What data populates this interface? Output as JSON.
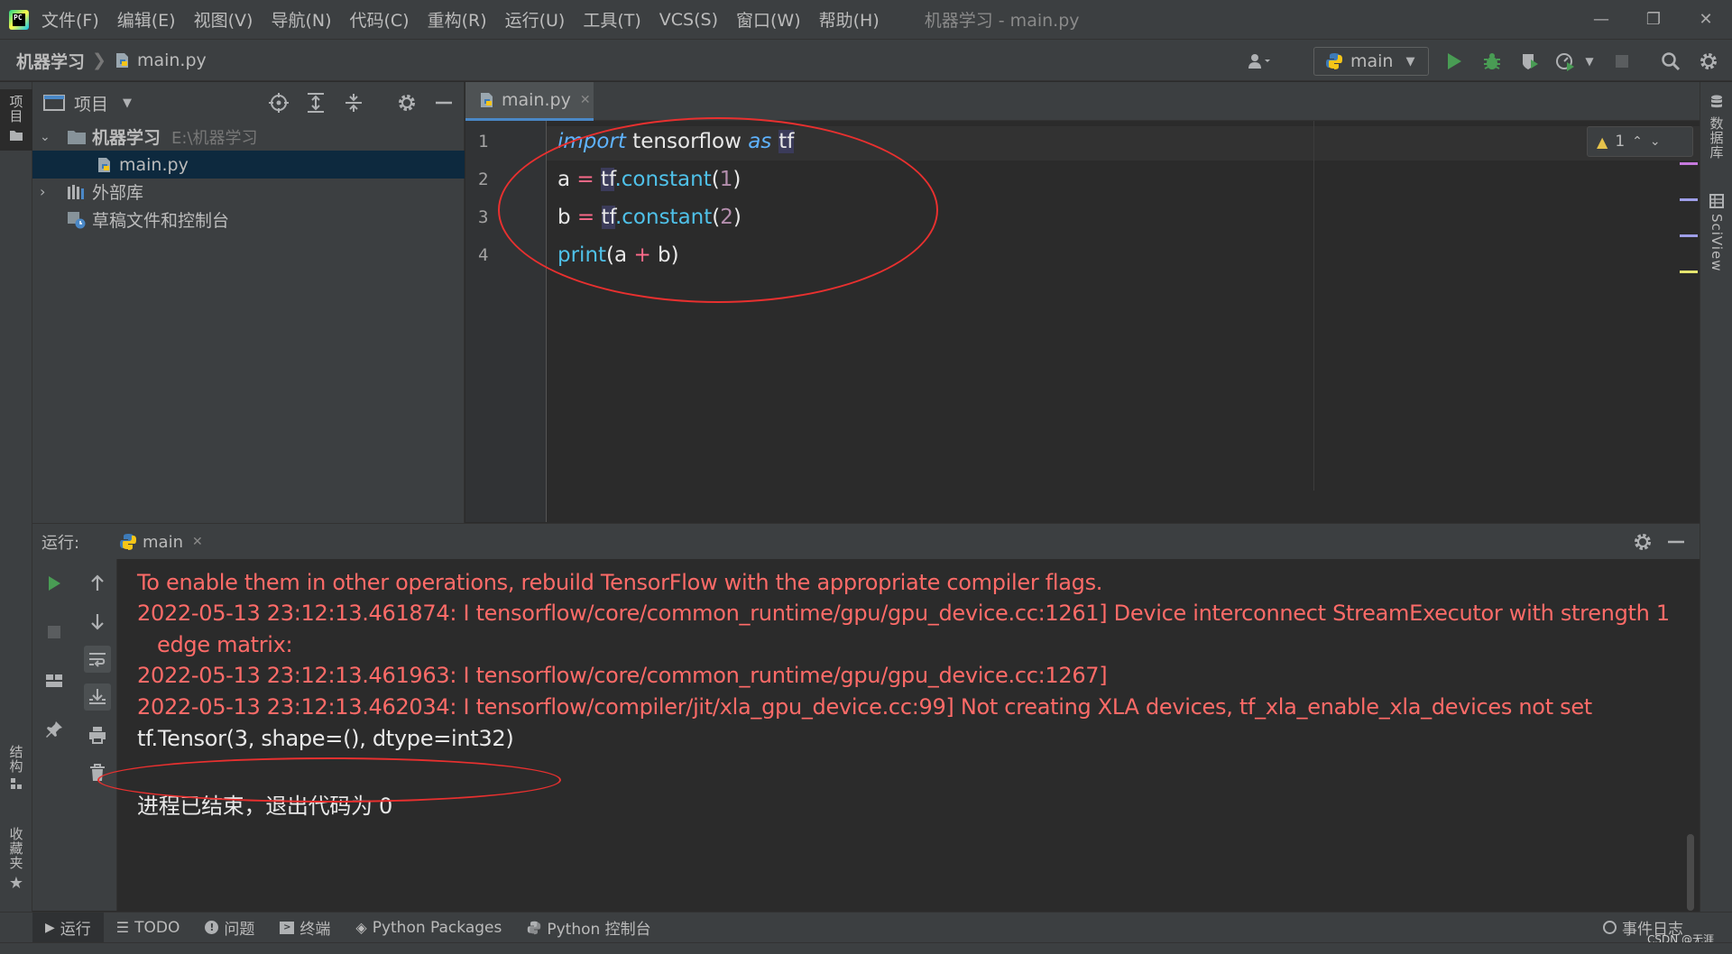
{
  "menubar": {
    "logo_text": "PC",
    "items": [
      "文件(F)",
      "编辑(E)",
      "视图(V)",
      "导航(N)",
      "代码(C)",
      "重构(R)",
      "运行(U)",
      "工具(T)",
      "VCS(S)",
      "窗口(W)",
      "帮助(H)"
    ],
    "window_title": "机器学习 - main.py"
  },
  "navbar": {
    "project": "机器学习",
    "file": "main.py",
    "run_config": "main"
  },
  "left_strip": {
    "project_tab": "项目",
    "structure_tab": "结构",
    "favorites_tab": "收藏夹"
  },
  "right_strip": {
    "database_tab": "数据库",
    "sciview_tab": "SciView"
  },
  "project_panel": {
    "title": "项目",
    "root_name": "机器学习",
    "root_path": "E:\\机器学习",
    "file": "main.py",
    "external_libs": "外部库",
    "scratches": "草稿文件和控制台"
  },
  "editor": {
    "tab": "main.py",
    "line_numbers": [
      "1",
      "2",
      "3",
      "4"
    ],
    "code": {
      "l1_kw1": "import",
      "l1_mod": " tensorflow ",
      "l1_kw2": "as",
      "l1_alias": "tf",
      "l2_var": "a ",
      "l2_eq": "=",
      "l2_tf": "tf",
      "l2_fn": ".constant",
      "l2_open": "(",
      "l2_num": "1",
      "l2_close": ")",
      "l3_var": "b ",
      "l3_eq": "=",
      "l3_tf": "tf",
      "l3_fn": ".constant",
      "l3_open": "(",
      "l3_num": "2",
      "l3_close": ")",
      "l4_fn": "print",
      "l4_open": "(a ",
      "l4_op": "+",
      "l4_close": " b)"
    },
    "inspection_count": "1",
    "marker_colors": [
      "#c679dd",
      "#9e9ee8",
      "#9e9ee8",
      "#e5e56f"
    ]
  },
  "run_window": {
    "label": "运行:",
    "tab": "main",
    "lines": [
      {
        "text": "To enable them in other operations, rebuild TensorFlow with the appropriate compiler flags.",
        "kind": "err"
      },
      {
        "text": "2022-05-13 23:12:13.461874: I tensorflow/core/common_runtime/gpu/gpu_device.cc:1261] Device interconnect StreamExecutor with strength 1",
        "kind": "err"
      },
      {
        "text": "   edge matrix:",
        "kind": "err"
      },
      {
        "text": "2022-05-13 23:12:13.461963: I tensorflow/core/common_runtime/gpu/gpu_device.cc:1267]",
        "kind": "err"
      },
      {
        "text": "2022-05-13 23:12:13.462034: I tensorflow/compiler/jit/xla_gpu_device.cc:99] Not creating XLA devices, tf_xla_enable_xla_devices not set",
        "kind": "err"
      },
      {
        "text": "tf.Tensor(3, shape=(), dtype=int32)",
        "kind": "out"
      },
      {
        "text": "进程已结束，退出代码为 0",
        "kind": "out"
      }
    ]
  },
  "bottom_tabs": {
    "run": "运行",
    "todo": "TODO",
    "problems": "问题",
    "terminal": "终端",
    "python_packages": "Python Packages",
    "python_console": "Python 控制台",
    "event_log": "事件日志"
  },
  "watermark": "CSDN @无涯",
  "colors": {
    "accent": "#4a88c7",
    "run_green": "#499c54",
    "annotation_red": "#e8302f",
    "error_text": "#ff6b68"
  }
}
